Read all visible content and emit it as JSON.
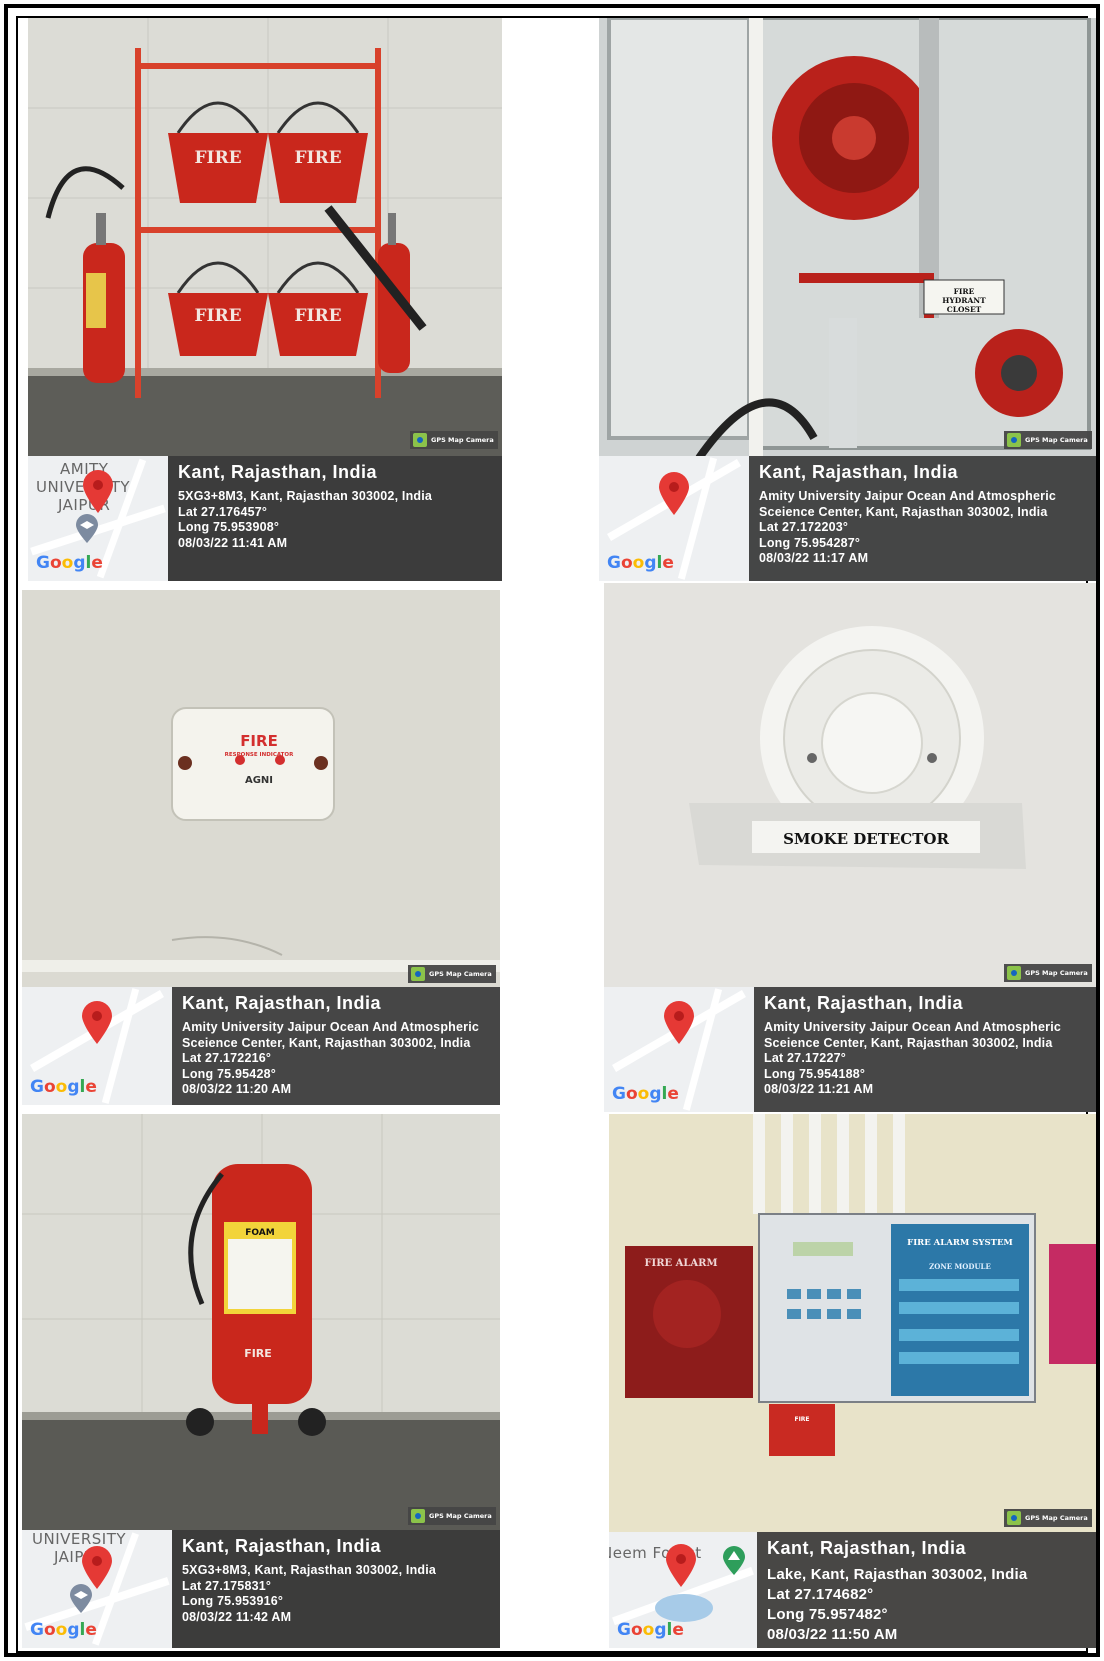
{
  "watermark": "GPS Map Camera",
  "google_label": "Google",
  "panels": [
    {
      "place": "Kant, Rajasthan, India",
      "lines": [
        "5XG3+8M3, Kant, Rajasthan 303002, India",
        "Lat 27.176457°",
        "Long 75.953908°",
        "08/03/22 11:41 AM"
      ],
      "map_text": [
        "AMITY",
        "UNIVERSITY",
        "JAIPUR"
      ],
      "photo_labels": [
        "FIRE",
        "FIRE",
        "FIRE",
        "FIRE"
      ]
    },
    {
      "place": "Kant, Rajasthan, India",
      "lines": [
        "Amity University Jaipur Ocean And Atmospheric",
        "Sceience Center, Kant, Rajasthan 303002, India",
        "Lat 27.172203°",
        "Long 75.954287°",
        "08/03/22 11:17 AM"
      ],
      "map_text": [],
      "photo_labels": [
        "FIRE",
        "HYDRANT",
        "CLOSET"
      ]
    },
    {
      "place": "Kant, Rajasthan, India",
      "lines": [
        "Amity University Jaipur Ocean And Atmospheric",
        "Sceience Center, Kant, Rajasthan 303002, India",
        "Lat 27.172216°",
        "Long 75.95428°",
        "08/03/22 11:20 AM"
      ],
      "map_text": [],
      "photo_labels": [
        "FIRE",
        "RESPONSE INDICATOR",
        "AGNI"
      ]
    },
    {
      "place": "Kant, Rajasthan, India",
      "lines": [
        "Amity University Jaipur Ocean And Atmospheric",
        "Sceience Center, Kant, Rajasthan 303002, India",
        "Lat 27.17227°",
        "Long 75.954188°",
        "08/03/22 11:21 AM"
      ],
      "map_text": [],
      "photo_labels": [
        "SMOKE DETECTOR"
      ]
    },
    {
      "place": "Kant, Rajasthan, India",
      "lines": [
        "5XG3+8M3, Kant, Rajasthan 303002, India",
        "Lat 27.175831°",
        "Long 75.953916°",
        "08/03/22 11:42 AM"
      ],
      "map_text": [
        "UNIVERSITY",
        "JAIPUR"
      ],
      "photo_labels": [
        "FOAM",
        "FIRE"
      ]
    },
    {
      "place": "Kant, Rajasthan, India",
      "lines": [
        "Lake, Kant, Rajasthan 303002, India",
        "Lat 27.174682°",
        "Long 75.957482°",
        "08/03/22 11:50 AM"
      ],
      "map_text": [
        "Neem Forest"
      ],
      "photo_labels": [
        "FIRE ALARM",
        "FIRE ALARM SYSTEM",
        "ZONE MODULE",
        "FIRE"
      ]
    }
  ]
}
